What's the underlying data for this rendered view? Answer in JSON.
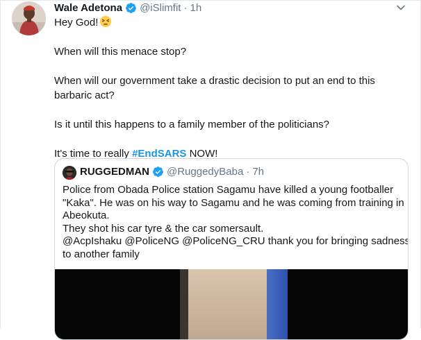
{
  "tweet": {
    "author_name": "Wale Adetona",
    "handle": "@iSlimfit",
    "separator": "·",
    "time": "1h",
    "paragraphs": [
      "Hey God!",
      "When will this menace stop?",
      "When will our government take a drastic decision to put an end to this barbaric act?",
      "Is it until this happens to a family member of the politicians?"
    ],
    "closing_prefix": "It's time to really ",
    "hashtag": "#EndSARS",
    "closing_suffix": " NOW!"
  },
  "quoted_tweet": {
    "author_name": "RUGGEDMAN",
    "handle": "@RuggedyBaba",
    "separator": "·",
    "time": "7h",
    "lines": [
      "Police from Obada Police station Sagamu have killed a young footballer",
      "\"Kaka\". He was on his way to Sagamu and he was coming from training in",
      "Abeokuta.",
      "They shot his car tyre & the car somersault.",
      "@AcpIshaku @PoliceNG @PoliceNG_CRU thank you for bringing sadness",
      "to another family"
    ]
  },
  "icons": {
    "verified": "verified-badge-icon",
    "menu": "chevron-down-icon",
    "emoji": "tired-face-emoji-icon"
  },
  "colors": {
    "link": "#1b95e0",
    "secondary_text": "#657786",
    "verified": "#1da1f2"
  }
}
